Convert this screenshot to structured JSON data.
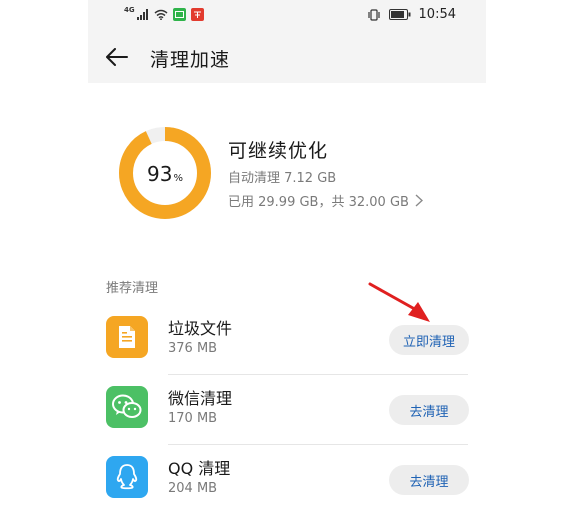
{
  "status_bar": {
    "network_label": "4G",
    "time": "10:54",
    "icons": [
      "signal-icon",
      "wifi-icon",
      "app-badge-green-icon",
      "app-badge-red-icon",
      "vibrate-icon",
      "battery-icon"
    ]
  },
  "header": {
    "title": "清理加速",
    "back_icon": "back-arrow-icon"
  },
  "summary": {
    "percent_value": "93",
    "percent_unit": "%",
    "percent_fraction": 0.93,
    "title": "可继续优化",
    "auto_clean": "自动清理 7.12 GB",
    "storage": "已用 29.99 GB，共 32.00 GB",
    "ring_color": "#f5a623",
    "ring_track_color": "#f0f0f0"
  },
  "section": {
    "title": "推荐清理",
    "items": [
      {
        "title": "垃圾文件",
        "size": "376 MB",
        "button": "立即清理",
        "icon": "file-icon",
        "color": "#f5a623"
      },
      {
        "title": "微信清理",
        "size": "170 MB",
        "button": "去清理",
        "icon": "wechat-icon",
        "color": "#4cc065"
      },
      {
        "title": "QQ 清理",
        "size": "204 MB",
        "button": "去清理",
        "icon": "qq-icon",
        "color": "#2ea7f0"
      }
    ]
  },
  "annotation": {
    "arrow_color": "#e02020"
  }
}
